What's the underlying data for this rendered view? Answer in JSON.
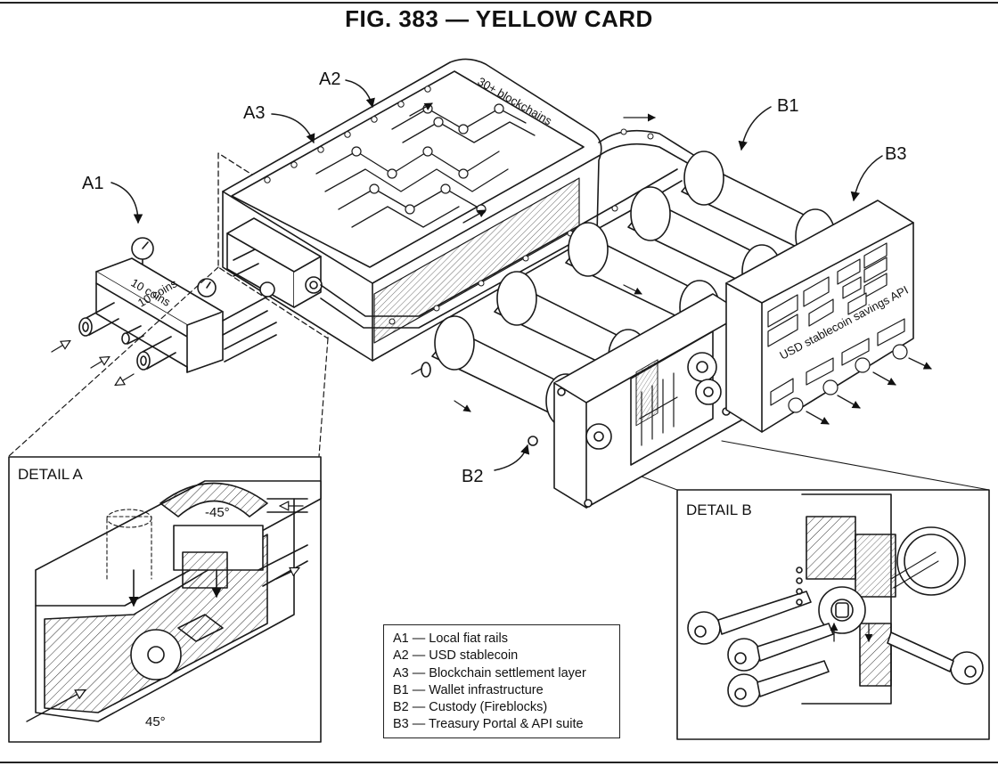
{
  "title": "FIG. 383 — YELLOW CARD",
  "labels": {
    "a1": "A1",
    "a2": "A2",
    "a3": "A3",
    "b1": "B1",
    "b2": "B2",
    "b3": "B3"
  },
  "engravings": {
    "manifold_upper": "10 coins",
    "manifold_lower": "10 coins",
    "chain_tank": "30+ blockchains",
    "panel_api": "USD stablecoin savings API"
  },
  "detail_a": {
    "title": "DETAIL A",
    "angle_top": "-45°",
    "angle_bottom": "45°"
  },
  "detail_b": {
    "title": "DETAIL B"
  },
  "legend": [
    "A1 — Local fiat rails",
    "A2 — USD stablecoin",
    "A3 — Blockchain settlement layer",
    "B1 — Wallet infrastructure",
    "B2 — Custody (Fireblocks)",
    "B3 — Treasury Portal & API suite"
  ]
}
